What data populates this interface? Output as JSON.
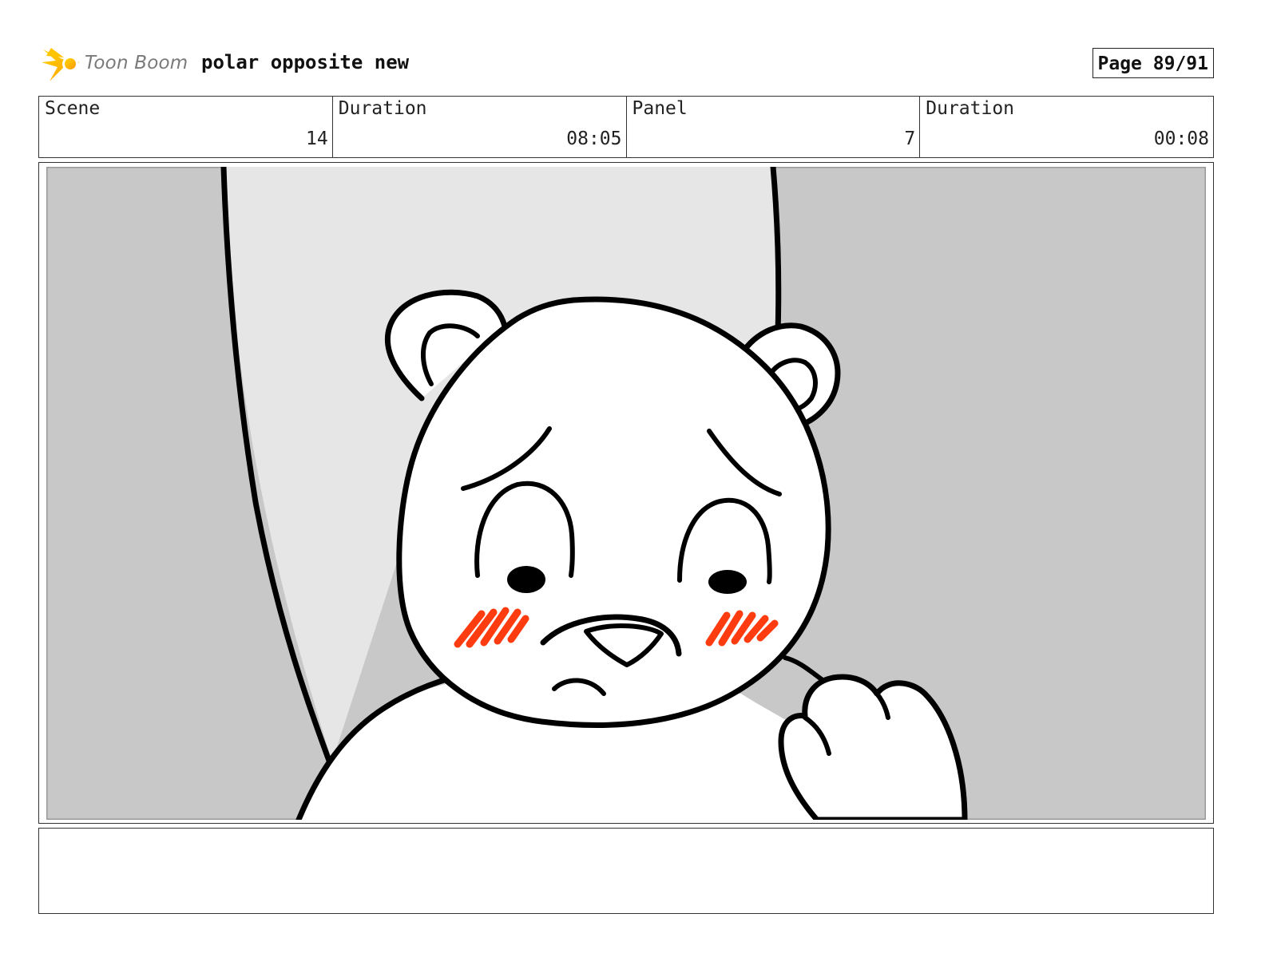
{
  "header": {
    "logo_text": "Toon Boom",
    "project_title": "polar opposite new",
    "page_label": "Page 89/91"
  },
  "info": {
    "scene_label": "Scene",
    "scene_value": "14",
    "scene_duration_label": "Duration",
    "scene_duration_value": "08:05",
    "panel_label": "Panel",
    "panel_value": "7",
    "panel_duration_label": "Duration",
    "panel_duration_value": "00:08"
  },
  "panel": {
    "image_subject": "polar-bear-sad-face",
    "colors": {
      "background_gray": "#c8c8c8",
      "door_light": "#e6e6e6",
      "outline": "#000000",
      "blush": "#ff3b10",
      "shadow": "#bdbdbd"
    }
  },
  "notes": {
    "text": ""
  }
}
